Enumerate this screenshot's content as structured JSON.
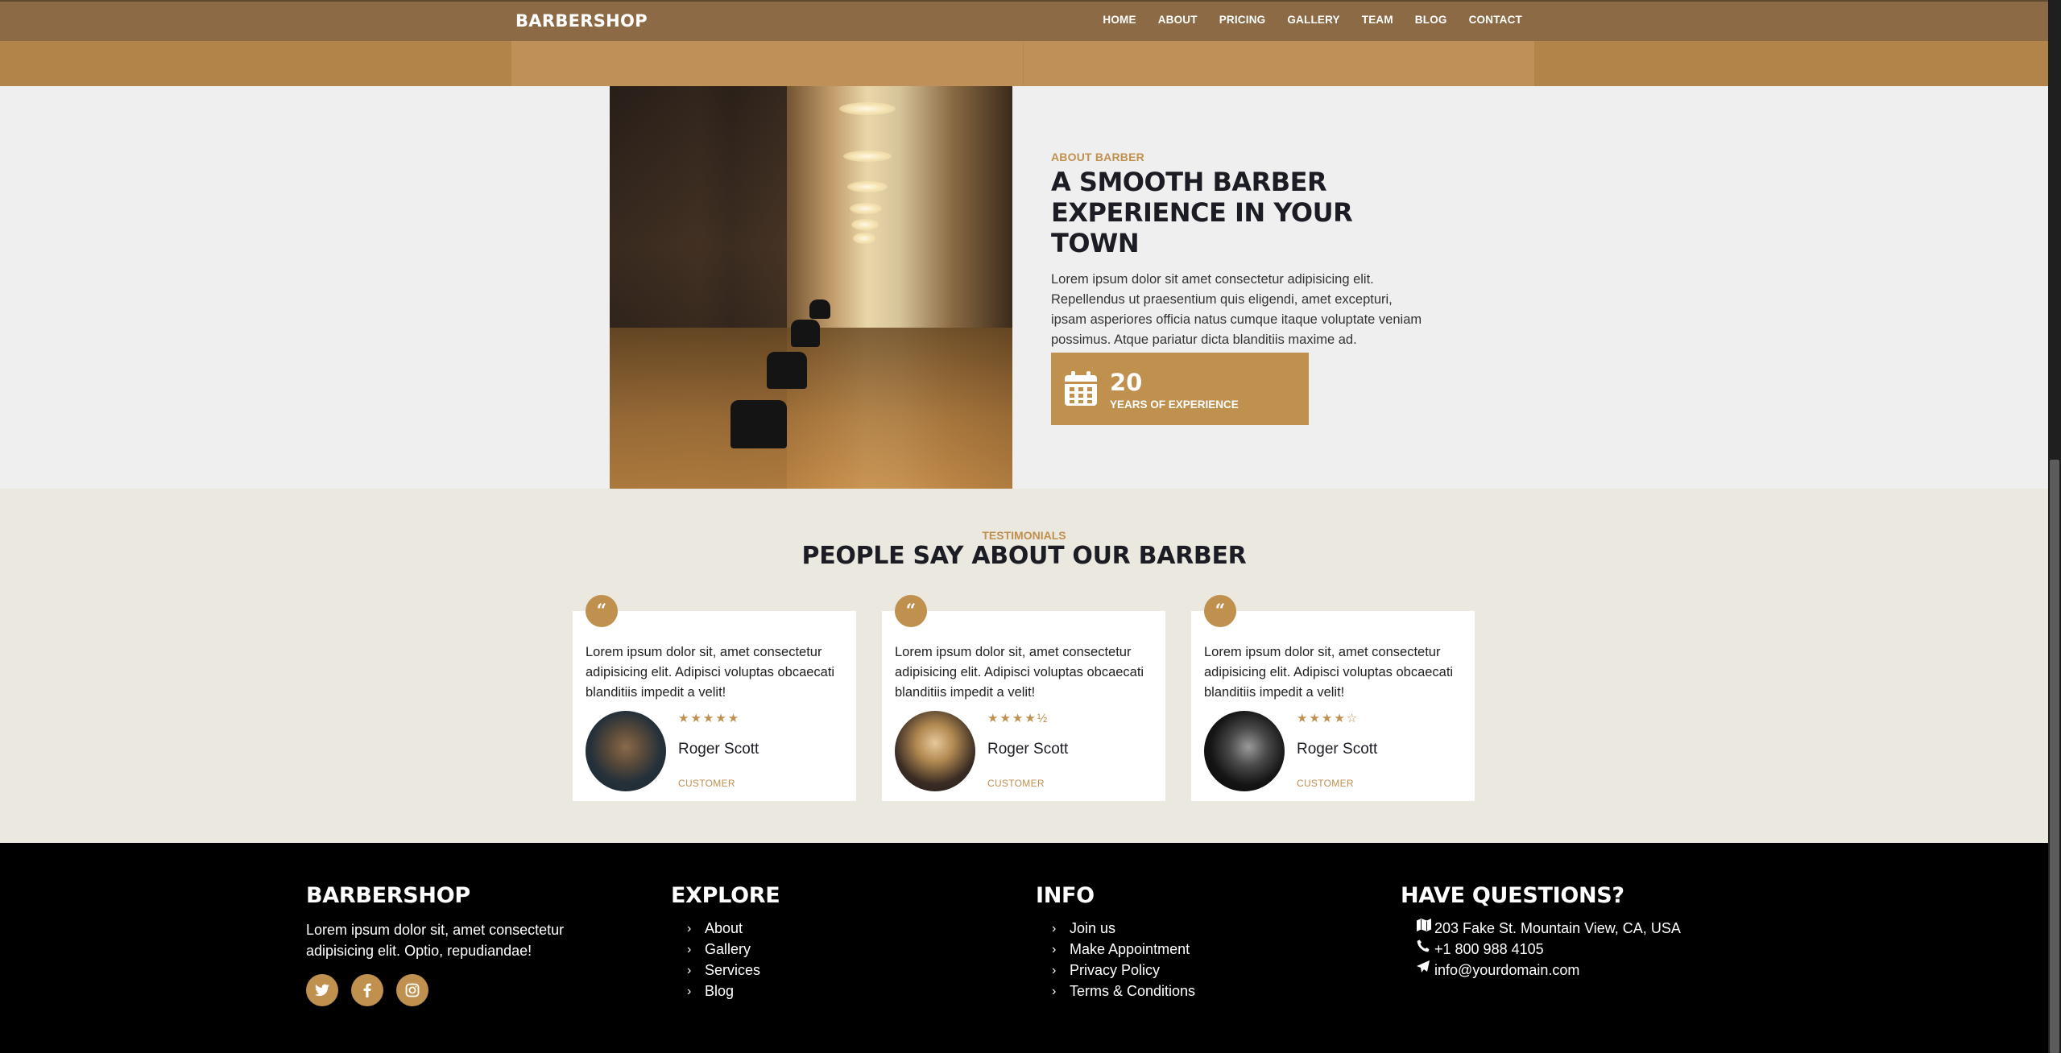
{
  "nav": {
    "brand": "BARBERSHOP",
    "links": [
      "HOME",
      "ABOUT",
      "PRICING",
      "GALLERY",
      "TEAM",
      "BLOG",
      "CONTACT"
    ]
  },
  "about": {
    "eyebrow": "ABOUT BARBER",
    "title": "A SMOOTH BARBER EXPERIENCE IN YOUR TOWN",
    "body": "Lorem ipsum dolor sit amet consectetur adipisicing elit. Repellendus ut praesentium quis eligendi, amet excepturi, ipsam asperiores officia natus cumque itaque voluptate veniam possimus. Atque pariatur dicta blanditiis maxime ad.",
    "experience_number": "20",
    "experience_label": "YEARS OF EXPERIENCE",
    "icon": "calendar-icon"
  },
  "testimonials": {
    "eyebrow": "TESTIMONIALS",
    "title": "PEOPLE SAY ABOUT OUR BARBER",
    "quote_glyph": "“",
    "items": [
      {
        "text": "Lorem ipsum dolor sit, amet consectetur adipisicing elit. Adipisci voluptas obcaecati blanditiis impedit a velit!",
        "stars": "★★★★★",
        "rating": 5,
        "name": "Roger Scott",
        "role": "CUSTOMER"
      },
      {
        "text": "Lorem ipsum dolor sit, amet consectetur adipisicing elit. Adipisci voluptas obcaecati blanditiis impedit a velit!",
        "stars": "★★★★½",
        "rating": 4.5,
        "name": "Roger Scott",
        "role": "CUSTOMER"
      },
      {
        "text": "Lorem ipsum dolor sit, amet consectetur adipisicing elit. Adipisci voluptas obcaecati blanditiis impedit a velit!",
        "stars": "★★★★☆",
        "rating": 4,
        "name": "Roger Scott",
        "role": "CUSTOMER"
      }
    ]
  },
  "footer": {
    "brand": {
      "heading": "BARBERSHOP",
      "text": "Lorem ipsum dolor sit, amet consectetur adipisicing elit. Optio, repudiandae!",
      "socials": [
        "twitter-icon",
        "facebook-icon",
        "instagram-icon"
      ]
    },
    "explore": {
      "heading": "EXPLORE",
      "links": [
        "About",
        "Gallery",
        "Services",
        "Blog"
      ]
    },
    "info": {
      "heading": "INFO",
      "links": [
        "Join us",
        "Make Appointment",
        "Privacy Policy",
        "Terms & Conditions"
      ]
    },
    "questions": {
      "heading": "HAVE QUESTIONS?",
      "address": "203 Fake St. Mountain View, CA, USA",
      "phone": "+1 800 988 4105",
      "email": "info@yourdomain.com"
    }
  },
  "colors": {
    "accent": "#c0904f",
    "nav": "#8b6a45",
    "dark": "#1c1c24",
    "footer": "#000000",
    "testimonials_bg": "#ebe8df"
  }
}
